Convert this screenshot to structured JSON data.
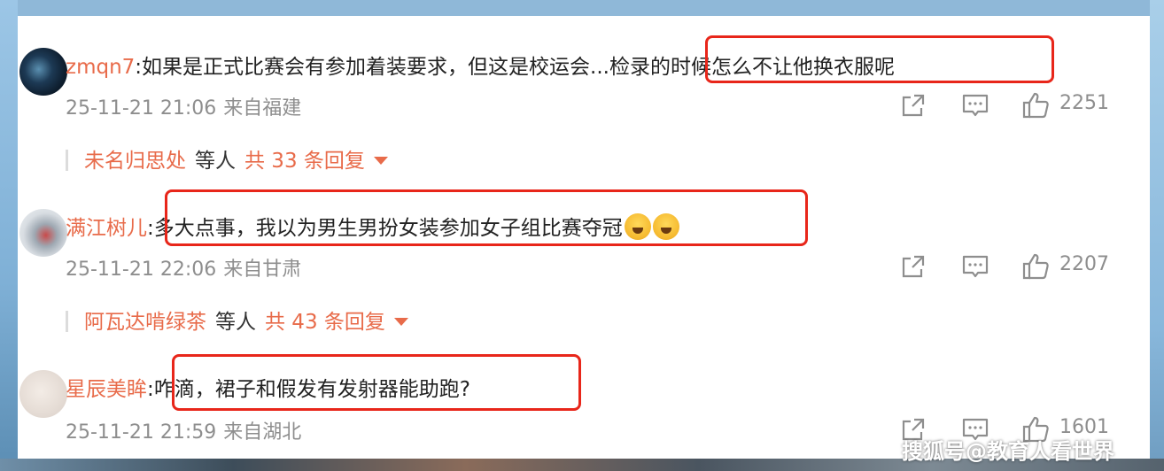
{
  "comments": [
    {
      "username": "zmqn7",
      "text_before": "如果是正式比赛会有参加着装要求，但这是校运会...",
      "text_highlight": "检录的时候怎么不让他换衣服呢",
      "time": "25-11-21 21:06",
      "location": "来自福建",
      "likes": "2251",
      "replies": {
        "name": "未名归思处",
        "etal": "等人",
        "total": "共 33 条回复"
      }
    },
    {
      "username": "满江树儿",
      "text_highlight": "多大点事，我以为男生男扮女装参加女子组比赛夺冠",
      "emojis": [
        "laugh-cry-emoji",
        "laugh-cry-emoji"
      ],
      "time": "25-11-21 22:06",
      "location": "来自甘肃",
      "likes": "2207",
      "replies": {
        "name": "阿瓦达啃绿茶",
        "etal": "等人",
        "total": "共 43 条回复"
      }
    },
    {
      "username": "星辰美眸",
      "text_highlight": "咋滴，裙子和假发有发射器能助跑?",
      "time": "25-11-21 21:59",
      "location": "来自湖北",
      "likes": "1601"
    }
  ],
  "icons": [
    "share-icon",
    "comment-icon",
    "like-icon"
  ],
  "colors": {
    "username": "#e86b4a",
    "highlight_border": "#e8261a",
    "meta": "#8e8e8e"
  },
  "watermark": "搜狐号@教育人看世界"
}
